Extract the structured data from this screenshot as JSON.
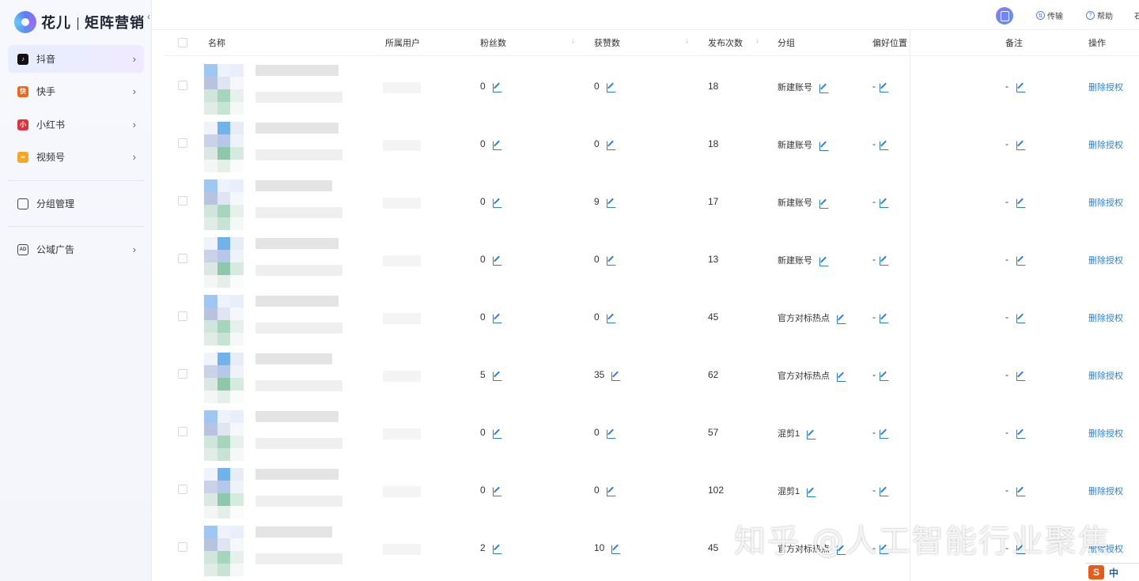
{
  "brand": {
    "name": "花儿",
    "product": "矩阵营销"
  },
  "sidebar": {
    "items": [
      {
        "label": "抖音",
        "icon": "douyin-icon",
        "color": "#111111",
        "active": true,
        "chevron": true
      },
      {
        "label": "快手",
        "icon": "kuaishou-icon",
        "color": "#f2631c",
        "active": false,
        "chevron": true
      },
      {
        "label": "小红书",
        "icon": "xiaohongshu-icon",
        "color": "#e0313b",
        "active": false,
        "chevron": true
      },
      {
        "label": "视频号",
        "icon": "shipinhao-icon",
        "color": "#f5a623",
        "active": false,
        "chevron": true
      },
      {
        "label": "分组管理",
        "icon": "group-manage-icon",
        "color": "#333333",
        "active": false,
        "chevron": false
      },
      {
        "label": "公域广告",
        "icon": "ad-icon",
        "color": "#333333",
        "active": false,
        "chevron": true
      }
    ]
  },
  "topbar": {
    "transfer": "传输",
    "help": "帮助",
    "more": "石"
  },
  "table": {
    "headers": {
      "name": "名称",
      "owner": "所属用户",
      "fans": "粉丝数",
      "likes": "获赞数",
      "posts": "发布次数",
      "group": "分组",
      "location": "偏好位置",
      "note": "备注",
      "ops": "操作"
    },
    "rows": [
      {
        "fans": "0",
        "likes": "0",
        "posts": "18",
        "group": "新建账号",
        "location": "-",
        "note": "-",
        "op": "删除授权"
      },
      {
        "fans": "0",
        "likes": "0",
        "posts": "18",
        "group": "新建账号",
        "location": "-",
        "note": "-",
        "op": "删除授权"
      },
      {
        "fans": "0",
        "likes": "9",
        "posts": "17",
        "group": "新建账号",
        "location": "-",
        "note": "-",
        "op": "删除授权"
      },
      {
        "fans": "0",
        "likes": "0",
        "posts": "13",
        "group": "新建账号",
        "location": "-",
        "note": "-",
        "op": "删除授权"
      },
      {
        "fans": "0",
        "likes": "0",
        "posts": "45",
        "group": "官方对标热点",
        "location": "-",
        "note": "-",
        "op": "删除授权"
      },
      {
        "fans": "5",
        "likes": "35",
        "posts": "62",
        "group": "官方对标热点",
        "location": "-",
        "note": "-",
        "op": "删除授权"
      },
      {
        "fans": "0",
        "likes": "0",
        "posts": "57",
        "group": "混剪1",
        "location": "-",
        "note": "-",
        "op": "删除授权"
      },
      {
        "fans": "0",
        "likes": "0",
        "posts": "102",
        "group": "混剪1",
        "location": "-",
        "note": "-",
        "op": "删除授权"
      },
      {
        "fans": "2",
        "likes": "10",
        "posts": "45",
        "group": "官方对标热点",
        "location": "-",
        "note": "-",
        "op": "删除授权"
      }
    ]
  },
  "watermark": "知乎 @人工智能行业聚焦",
  "ime": {
    "logo": "S",
    "mode": "中"
  },
  "colors": {
    "link": "#2b7fd8",
    "accent": "#5b7cf7"
  }
}
